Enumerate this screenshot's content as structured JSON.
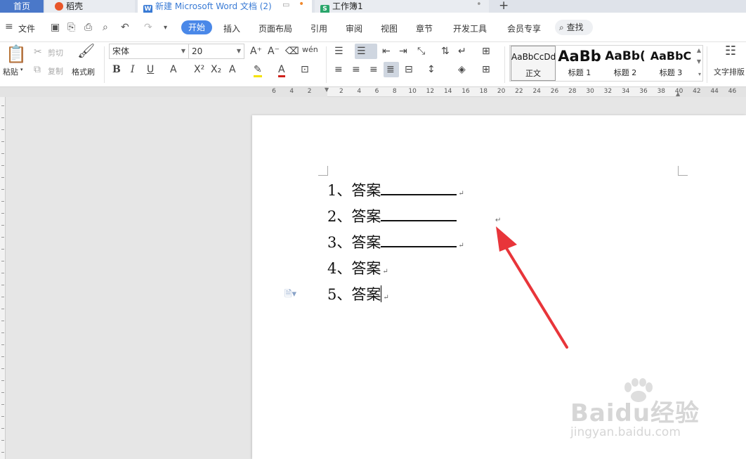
{
  "tabs": {
    "home": "首页",
    "docer": "稻壳",
    "doc_icon": "W",
    "doc": "新建 Microsoft Word 文档 (2)",
    "sheet_icon": "S",
    "sheet": "工作簿1",
    "new_tab": "+"
  },
  "menu": {
    "file": "文件",
    "home": "开始",
    "insert": "插入",
    "layout": "页面布局",
    "references": "引用",
    "review": "审阅",
    "view": "视图",
    "section": "章节",
    "developer": "开发工具",
    "member": "会员专享",
    "find": "查找"
  },
  "ribbon": {
    "paste": "粘贴",
    "cut": "剪切",
    "copy": "复制",
    "format_painter": "格式刷",
    "font_name": "宋体",
    "font_size": "20",
    "bold": "B",
    "italic": "I",
    "underline": "U",
    "text_direction": "文字排版",
    "styles": [
      {
        "sample": "AaBbCcDd",
        "name": "正文"
      },
      {
        "sample": "AaBb",
        "name": "标题 1"
      },
      {
        "sample": "AaBb(",
        "name": "标题 2"
      },
      {
        "sample": "AaBbC",
        "name": "标题 3"
      }
    ]
  },
  "ruler": {
    "ticks": [
      "6",
      "4",
      "2",
      "2",
      "4",
      "6",
      "8",
      "10",
      "12",
      "14",
      "16",
      "18",
      "20",
      "22",
      "24",
      "26",
      "28",
      "30",
      "32",
      "34",
      "36",
      "38",
      "40",
      "42",
      "44",
      "46"
    ]
  },
  "document": {
    "items": [
      {
        "number": "1、",
        "text": "答案",
        "has_blank": true
      },
      {
        "number": "2、",
        "text": "答案",
        "has_blank": true
      },
      {
        "number": "3、",
        "text": "答案",
        "has_blank": true
      },
      {
        "number": "4、",
        "text": "答案",
        "has_blank": false
      },
      {
        "number": "5、",
        "text": "答案",
        "has_blank": false
      }
    ],
    "para_mark": "↵"
  },
  "watermark": {
    "main": "Baidu经验",
    "sub": "jingyan.baidu.com"
  },
  "colors": {
    "accent": "#4a88e8",
    "home_tab": "#4a78c9",
    "arrow": "#e8353a"
  }
}
